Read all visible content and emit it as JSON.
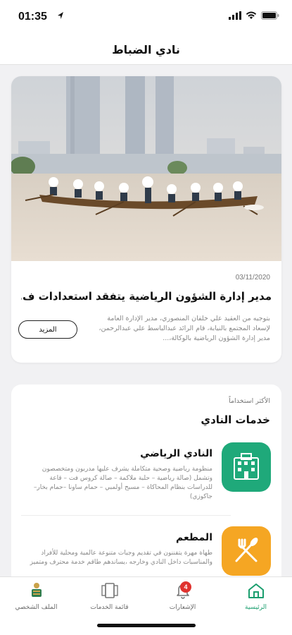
{
  "status": {
    "time": "01:35"
  },
  "nav": {
    "title": "نادي الضباط"
  },
  "news": {
    "date": "03/11/2020",
    "title": "مدير إدارة الشؤون الرياضية يتفقد استعدادات ف...",
    "body": "بتوجيه من العقيد علي خلفان المنصوري، مدير الإدارة العامة لإسعاد المجتمع بالنيابة، قام الرائد عبدالباسط علي عبدالرحمن، مدير إدارة الشؤون الرياضية بالوكالة،...",
    "more_label": "المزيد"
  },
  "services": {
    "kicker": "الأكثر استخداماً",
    "title": "خدمات النادي",
    "items": [
      {
        "name": "النادي الرياضي",
        "desc": "منظومة رياضية وصحية متكاملة يشرف عليها مدربون ومتخصصون وتشمل (صالة رياضية – حلبة ملاكمة – صالة كروس فت – قاعة للدراسات بنظام المحاكاة – مسبح أولمبي – حمام ساونا –حمام بخار– جاكوزي)",
        "icon": "building-icon",
        "color": "#1fa97a"
      },
      {
        "name": "المطعم",
        "desc": "طهاة مهرة يتفننون في تقديم وجبات متنوعة عالمية ومحلية للأفراد والمناسبات داخل النادي وخارجه ،يساندهم طاقم خدمة محترف ومتميز",
        "icon": "fork-knife-icon",
        "color": "#f5a623"
      }
    ]
  },
  "tabs": [
    {
      "label": "الرئيسية",
      "icon": "home-icon",
      "active": true
    },
    {
      "label": "الإشعارات",
      "icon": "bell-icon",
      "badge": "4"
    },
    {
      "label": "قائمة الخدمات",
      "icon": "services-list-icon"
    },
    {
      "label": "الملف الشخصي",
      "icon": "profile-emblem-icon"
    }
  ]
}
